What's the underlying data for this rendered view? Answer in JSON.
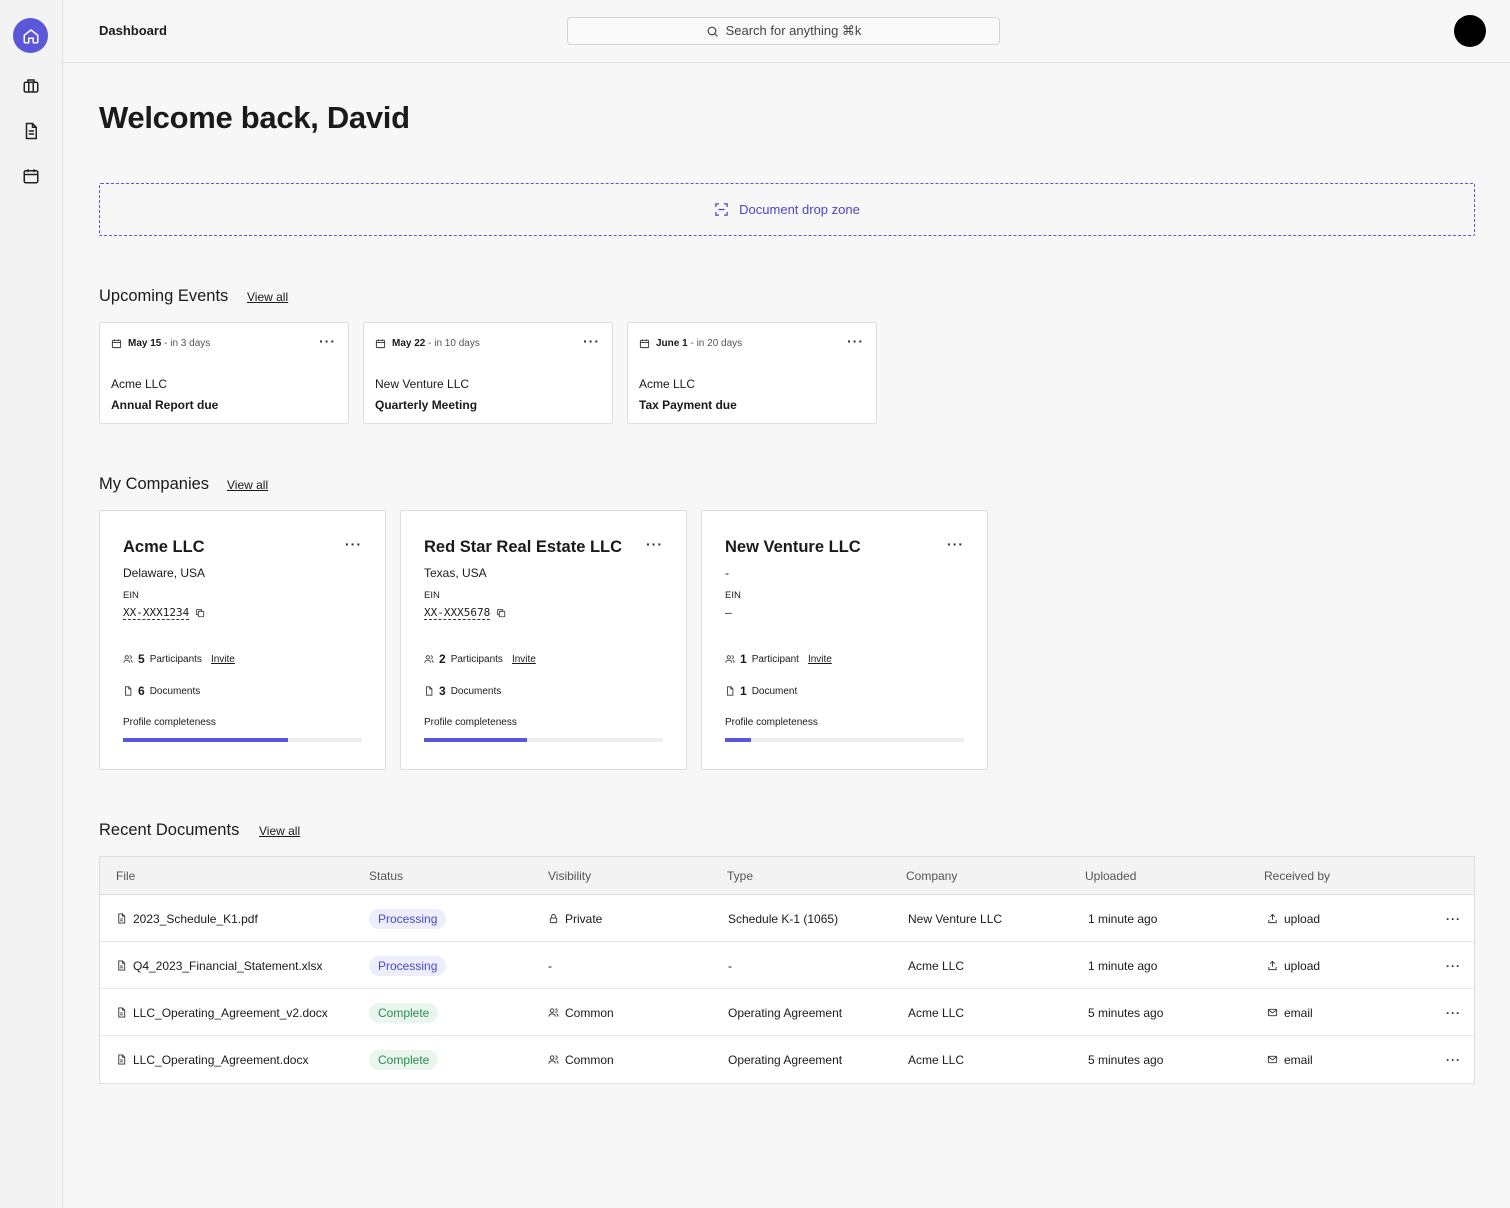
{
  "sidebar": {
    "items": [
      {
        "icon": "home-icon",
        "active": true
      },
      {
        "icon": "briefcase-icon",
        "active": false
      },
      {
        "icon": "document-icon",
        "active": false
      },
      {
        "icon": "calendar-icon",
        "active": false
      }
    ]
  },
  "header": {
    "breadcrumb": "Dashboard",
    "search_placeholder": "Search for anything ⌘k"
  },
  "welcome": "Welcome back, David",
  "dropzone": {
    "label": "Document drop zone"
  },
  "events": {
    "title": "Upcoming Events",
    "view_all": "View all",
    "items": [
      {
        "date": "May 15",
        "relative": " - in 3 days",
        "company": "Acme LLC",
        "title": "Annual Report due"
      },
      {
        "date": "May 22",
        "relative": " - in 10 days",
        "company": "New Venture LLC",
        "title": "Quarterly Meeting"
      },
      {
        "date": "June 1",
        "relative": " - in 20 days",
        "company": "Acme LLC",
        "title": "Tax Payment due"
      }
    ]
  },
  "companies": {
    "title": "My Companies",
    "view_all": "View all",
    "items": [
      {
        "name": "Acme LLC",
        "location": "Delaware, USA",
        "ein_label": "EIN",
        "ein": "XX-XXX1234",
        "participants": "5",
        "participants_label": "Participants",
        "invite": "Invite",
        "documents": "6",
        "documents_label": "Documents",
        "completeness_label": "Profile completeness",
        "completeness": 0.69
      },
      {
        "name": "Red Star Real Estate LLC",
        "location": "Texas, USA",
        "ein_label": "EIN",
        "ein": "XX-XXX5678",
        "participants": "2",
        "participants_label": "Participants",
        "invite": "Invite",
        "documents": "3",
        "documents_label": "Documents",
        "completeness_label": "Profile completeness",
        "completeness": 0.43
      },
      {
        "name": "New Venture LLC",
        "location": "-",
        "ein_label": "EIN",
        "ein": "–",
        "participants": "1",
        "participants_label": "Participant",
        "invite": "Invite",
        "documents": "1",
        "documents_label": "Document",
        "completeness_label": "Profile completeness",
        "completeness": 0.11
      }
    ]
  },
  "documents": {
    "title": "Recent Documents",
    "view_all": "View all",
    "columns": [
      "File",
      "Status",
      "Visibility",
      "Type",
      "Company",
      "Uploaded",
      "Received by"
    ],
    "rows": [
      {
        "file": "2023_Schedule_K1.pdf",
        "status": "Processing",
        "visibility": "Private",
        "visibility_icon": "lock-icon",
        "type": "Schedule K-1 (1065)",
        "company": "New Venture LLC",
        "uploaded": "1 minute ago",
        "received": "upload",
        "received_icon": "upload-icon"
      },
      {
        "file": "Q4_2023_Financial_Statement.xlsx",
        "status": "Processing",
        "visibility": "-",
        "visibility_icon": "",
        "type": "-",
        "company": "Acme LLC",
        "uploaded": "1 minute ago",
        "received": "upload",
        "received_icon": "upload-icon"
      },
      {
        "file": "LLC_Operating_Agreement_v2.docx",
        "status": "Complete",
        "visibility": "Common",
        "visibility_icon": "users-icon",
        "type": "Operating Agreement",
        "company": "Acme LLC",
        "uploaded": "5 minutes ago",
        "received": "email",
        "received_icon": "mail-icon"
      },
      {
        "file": "LLC_Operating_Agreement.docx",
        "status": "Complete",
        "visibility": "Common",
        "visibility_icon": "users-icon",
        "type": "Operating Agreement",
        "company": "Acme LLC",
        "uploaded": "5 minutes ago",
        "received": "email",
        "received_icon": "mail-icon"
      }
    ]
  },
  "colors": {
    "accent": "#5b57d8",
    "processing_bg": "#eceefc",
    "complete_bg": "#e9f6ee",
    "complete_text": "#2f8a53"
  }
}
